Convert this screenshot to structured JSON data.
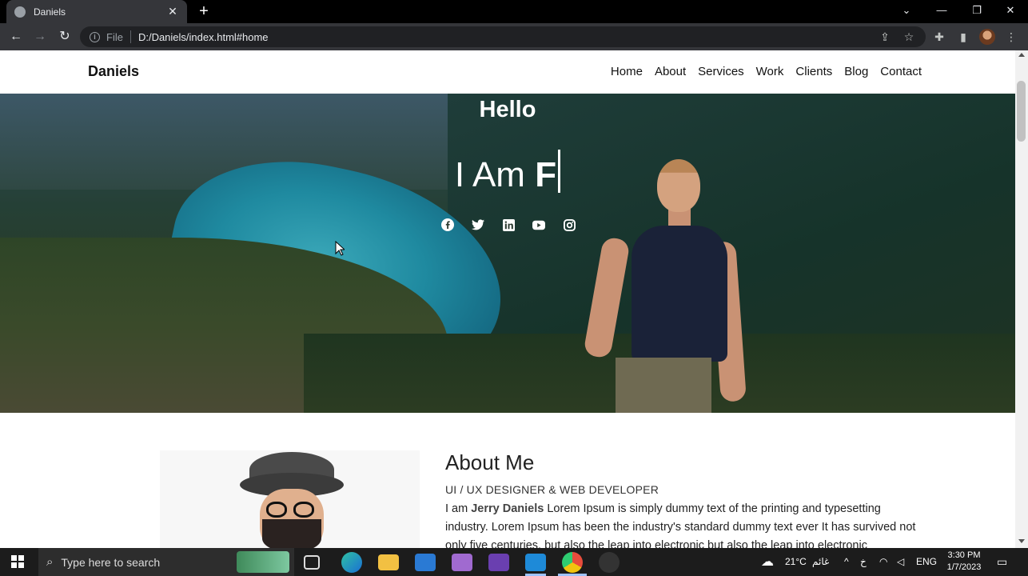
{
  "browser": {
    "tab_title": "Daniels",
    "address_scheme": "File",
    "address_url": "D:/Daniels/index.html#home"
  },
  "site": {
    "brand": "Daniels",
    "nav": [
      "Home",
      "About",
      "Services",
      "Work",
      "Clients",
      "Blog",
      "Contact"
    ],
    "hero": {
      "greeting": "Hello",
      "typed_prefix": "I Am",
      "typed_word": "F",
      "socials": [
        "facebook-icon",
        "twitter-icon",
        "linkedin-icon",
        "youtube-icon",
        "instagram-icon"
      ]
    },
    "about": {
      "title": "About Me",
      "subtitle": "UI / UX DESIGNER & WEB DEVELOPER",
      "intro": "I am",
      "name": "Jerry Daniels",
      "body": "Lorem Ipsum is simply dummy text of the printing and typesetting industry. Lorem Ipsum has been the industry's standard dummy text ever It has survived not only five centuries, but also the leap into electronic but also the leap into electronic"
    }
  },
  "taskbar": {
    "search_placeholder": "Type here to search",
    "weather_temp": "21°C",
    "weather_text": "غائم",
    "language": "ENG",
    "time": "3:30 PM",
    "date": "1/7/2023"
  },
  "colors": {
    "chrome_dark": "#35363a",
    "omnibox": "#202124",
    "taskbar": "#1c1c1c"
  }
}
